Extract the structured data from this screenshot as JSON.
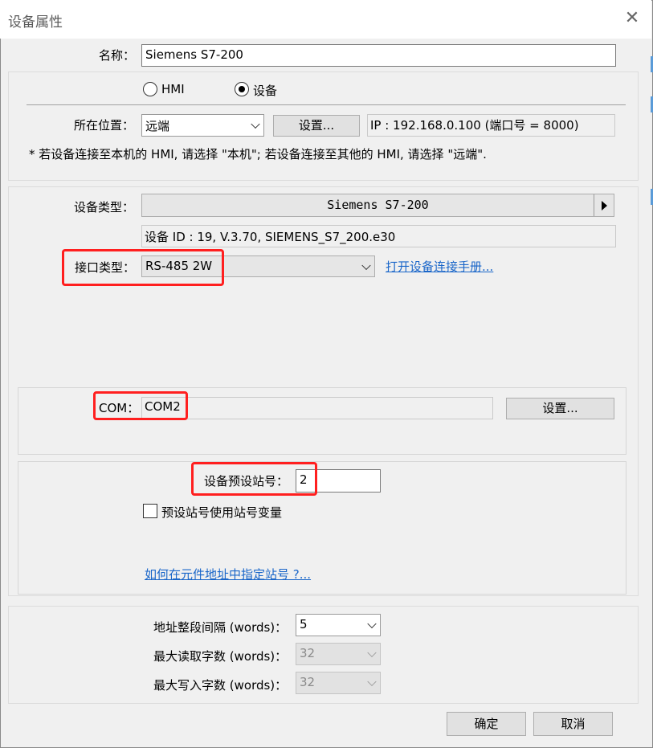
{
  "window": {
    "title": "设备属性",
    "close": "✕"
  },
  "name_field": {
    "label": "名称：",
    "value": "Siemens S7-200"
  },
  "location": {
    "radio_hmi": "HMI",
    "radio_device": "设备",
    "selected": "device",
    "label": "所在位置：",
    "value": "远端",
    "settings_button": "设置...",
    "ip_info": "IP : 192.168.0.100 (端口号 = 8000)",
    "note": "* 若设备连接至本机的 HMI, 请选择 \"本机\"; 若设备连接至其他的 HMI, 请选择 \"远端\"."
  },
  "device": {
    "type_label": "设备类型：",
    "type_value": "Siemens S7-200",
    "id_info": "设备 ID : 19, V.3.70, SIEMENS_S7_200.e30",
    "interface_label": "接口类型：",
    "interface_value": "RS-485 2W",
    "manual_link": "打开设备连接手册..."
  },
  "com": {
    "label": "COM：",
    "value": "COM2",
    "settings_button": "设置..."
  },
  "station": {
    "label": "设备预设站号：",
    "value": "2",
    "use_var_label": "预设站号使用站号变量",
    "use_var_checked": false,
    "help_link": "如何在元件地址中指定站号 ?..."
  },
  "address": {
    "interval_label": "地址整段间隔 (words)：",
    "interval_value": "5",
    "max_read_label": "最大读取字数 (words)：",
    "max_read_value": "32",
    "max_write_label": "最大写入字数 (words)：",
    "max_write_value": "32"
  },
  "footer": {
    "ok_button": "确定",
    "cancel_button": "取消"
  },
  "colors": {
    "highlight": "#ff1f1f",
    "link": "#1a66c9",
    "background": "#f0f0f0"
  }
}
